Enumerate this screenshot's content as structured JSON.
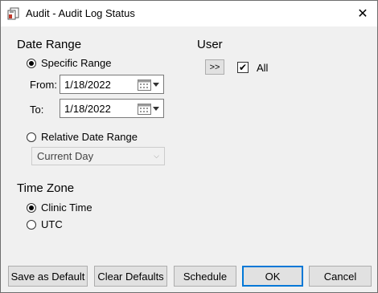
{
  "window": {
    "title": "Audit - Audit Log Status",
    "close_glyph": "✕"
  },
  "date_range": {
    "heading": "Date Range",
    "specific_label": "Specific Range",
    "from_label": "From:",
    "from_value": "1/18/2022",
    "to_label": "To:",
    "to_value": "1/18/2022",
    "relative_label": "Relative Date Range",
    "relative_selected": "Current Day",
    "specific_selected": true
  },
  "user": {
    "heading": "User",
    "expand_button": ">>",
    "all_label": "All",
    "all_checked": true,
    "check_glyph": "✔"
  },
  "time_zone": {
    "heading": "Time Zone",
    "clinic_label": "Clinic Time",
    "utc_label": "UTC",
    "clinic_selected": true
  },
  "buttons": {
    "save_default": "Save as Default",
    "clear_defaults": "Clear Defaults",
    "schedule": "Schedule",
    "ok": "OK",
    "cancel": "Cancel"
  },
  "icons": {
    "app": "audit-app-icon",
    "calendar": "calendar-icon",
    "dropdown": "chevron-down-icon",
    "close": "close-icon"
  },
  "colors": {
    "accent": "#0078d7",
    "button_bg": "#e1e1e1",
    "window_bg": "#f0f0f0"
  }
}
